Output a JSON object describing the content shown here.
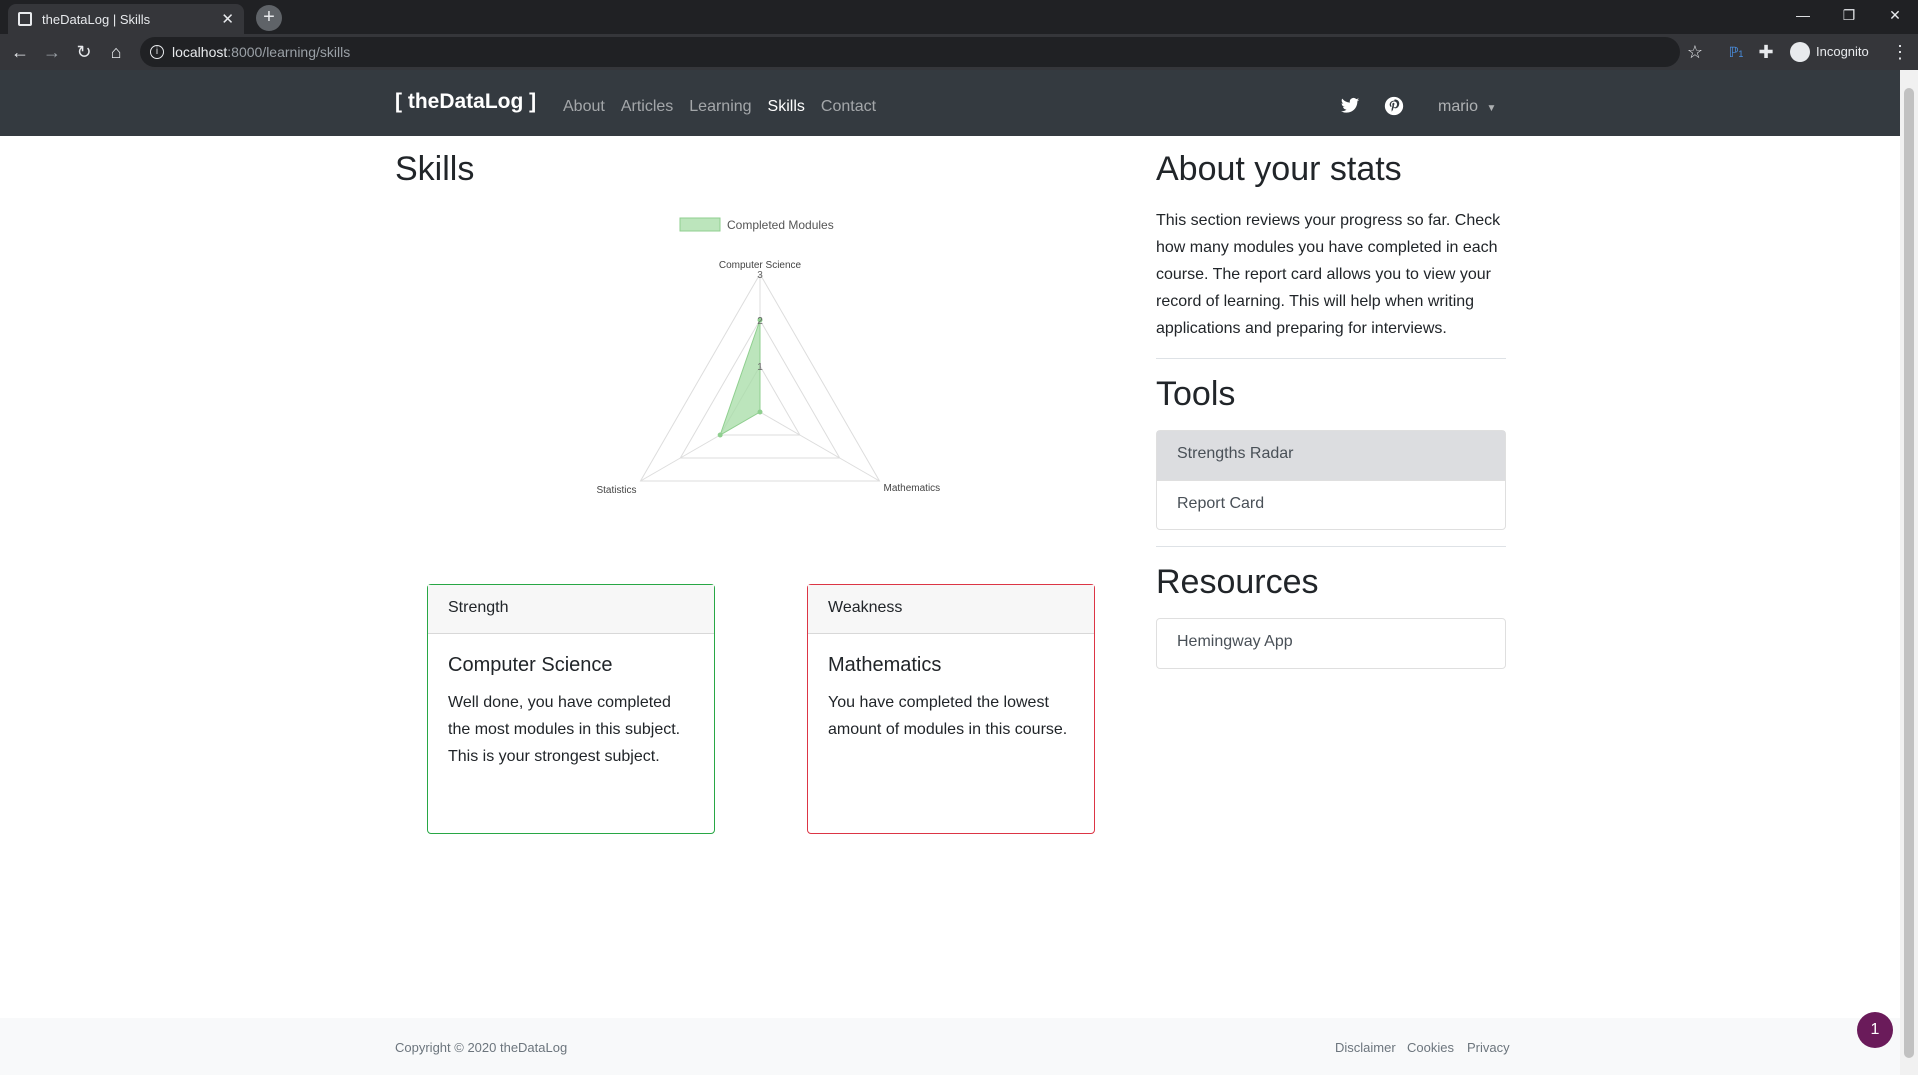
{
  "browser": {
    "tab_title": "theDataLog | Skills",
    "url_host": "localhost",
    "url_rest": ":8000/learning/skills",
    "profile": "Incognito",
    "extension_badge": "1"
  },
  "nav": {
    "brand": "[ theDataLog ]",
    "links": [
      {
        "label": "About",
        "active": false
      },
      {
        "label": "Articles",
        "active": false
      },
      {
        "label": "Learning",
        "active": false
      },
      {
        "label": "Skills",
        "active": true
      },
      {
        "label": "Contact",
        "active": false
      }
    ],
    "user": "mario"
  },
  "main": {
    "title": "Skills"
  },
  "chart_data": {
    "type": "radar",
    "legend": "Completed Modules",
    "legend_position": "top",
    "categories": [
      "Computer Science",
      "Mathematics",
      "Statistics"
    ],
    "series": [
      {
        "name": "Completed Modules",
        "values": [
          2,
          0,
          1
        ]
      }
    ],
    "ticks": [
      "1",
      "2",
      "3"
    ],
    "range": [
      0,
      3
    ],
    "color": "#a6dca6"
  },
  "cards": {
    "strength": {
      "header": "Strength",
      "title": "Computer Science",
      "text": "Well done, you have completed the most modules in this subject. This is your strongest subject.",
      "border": "#28a745"
    },
    "weakness": {
      "header": "Weakness",
      "title": "Mathematics",
      "text": "You have completed the lowest amount of modules in this course.",
      "border": "#dc3545"
    }
  },
  "sidebar": {
    "about_title": "About your stats",
    "about_text": "This section reviews your progress so far. Check how many modules you have completed in each course. The report card allows you to view your record of learning. This will help when writing applications and preparing for interviews.",
    "tools_title": "Tools",
    "tools": [
      {
        "label": "Strengths Radar",
        "active": true
      },
      {
        "label": "Report Card",
        "active": false
      }
    ],
    "resources_title": "Resources",
    "resources": [
      {
        "label": "Hemingway App"
      }
    ]
  },
  "footer": {
    "copyright": "Copyright © 2020 theDataLog",
    "links": [
      "Disclaimer",
      "Cookies",
      "Privacy"
    ]
  },
  "floating_badge": "1",
  "icons": [
    "back-icon",
    "forward-icon",
    "reload-icon",
    "home-icon",
    "info-icon",
    "star-icon",
    "puzzle-icon",
    "twitter-icon",
    "pinterest-icon",
    "chevron-down-icon"
  ]
}
